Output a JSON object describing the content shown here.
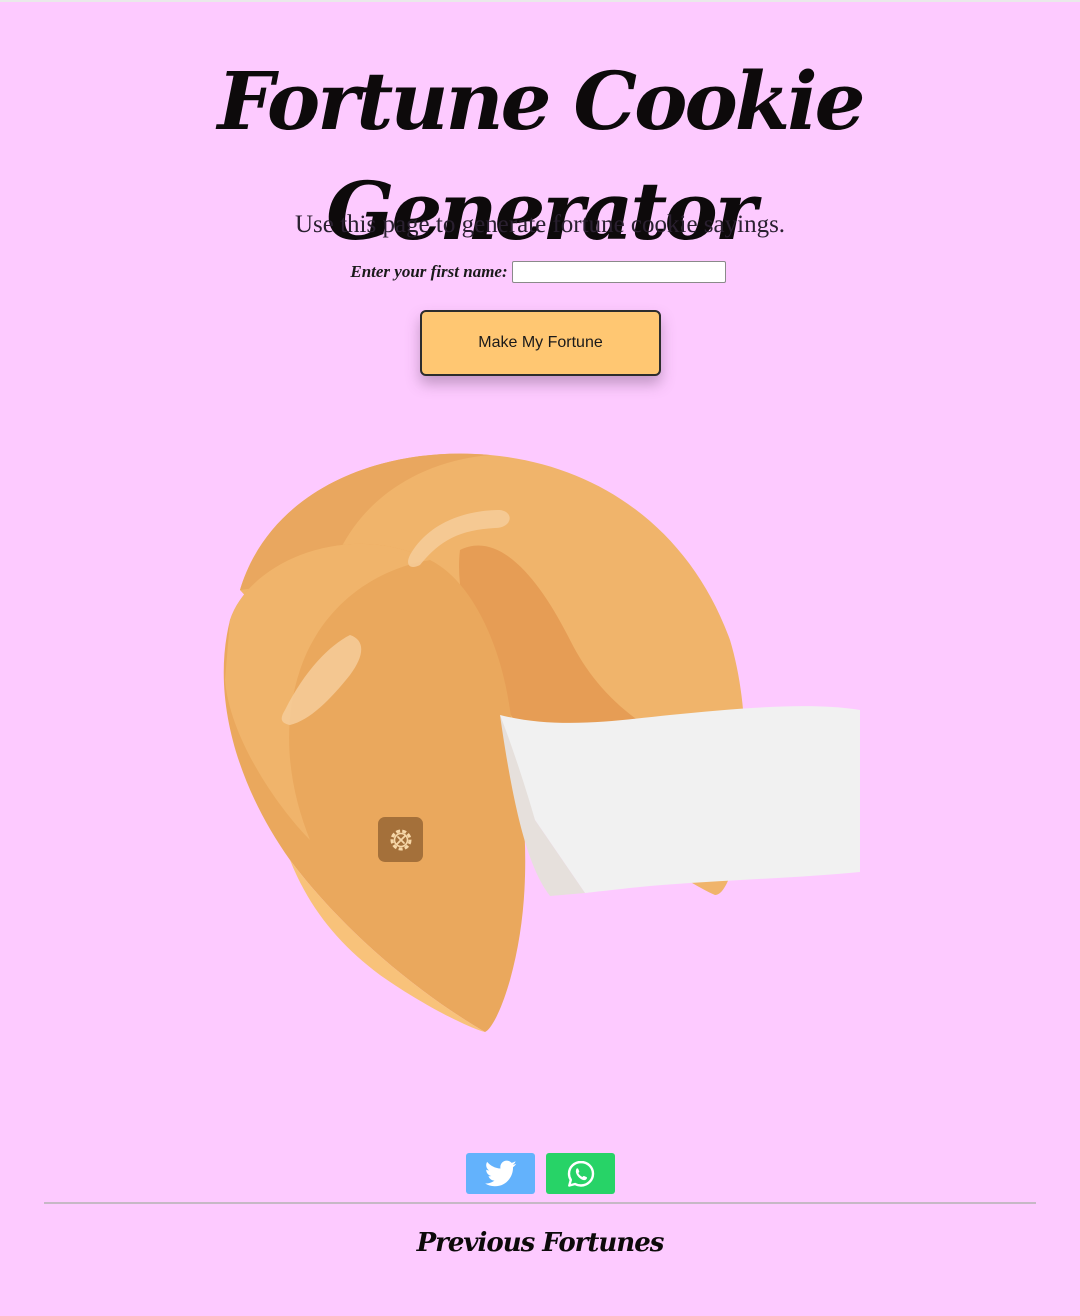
{
  "header": {
    "title": "Fortune Cookie Generator"
  },
  "intro": {
    "text": "Use this page to generate fortune cookie sayings."
  },
  "form": {
    "name_label": "Enter your first name:",
    "name_value": "",
    "button_label": "Make My Fortune"
  },
  "cookie": {
    "image_icon": "fortune-cookie-illustration",
    "overlay_icon": "settings-gear-icon"
  },
  "share": {
    "twitter_icon": "twitter-bird-icon",
    "whatsapp_icon": "whatsapp-icon"
  },
  "previous": {
    "heading": "Previous Fortunes"
  },
  "colors": {
    "background": "#fdcaff",
    "button": "#ffc772",
    "twitter": "#63b2fc",
    "whatsapp": "#27d367"
  }
}
